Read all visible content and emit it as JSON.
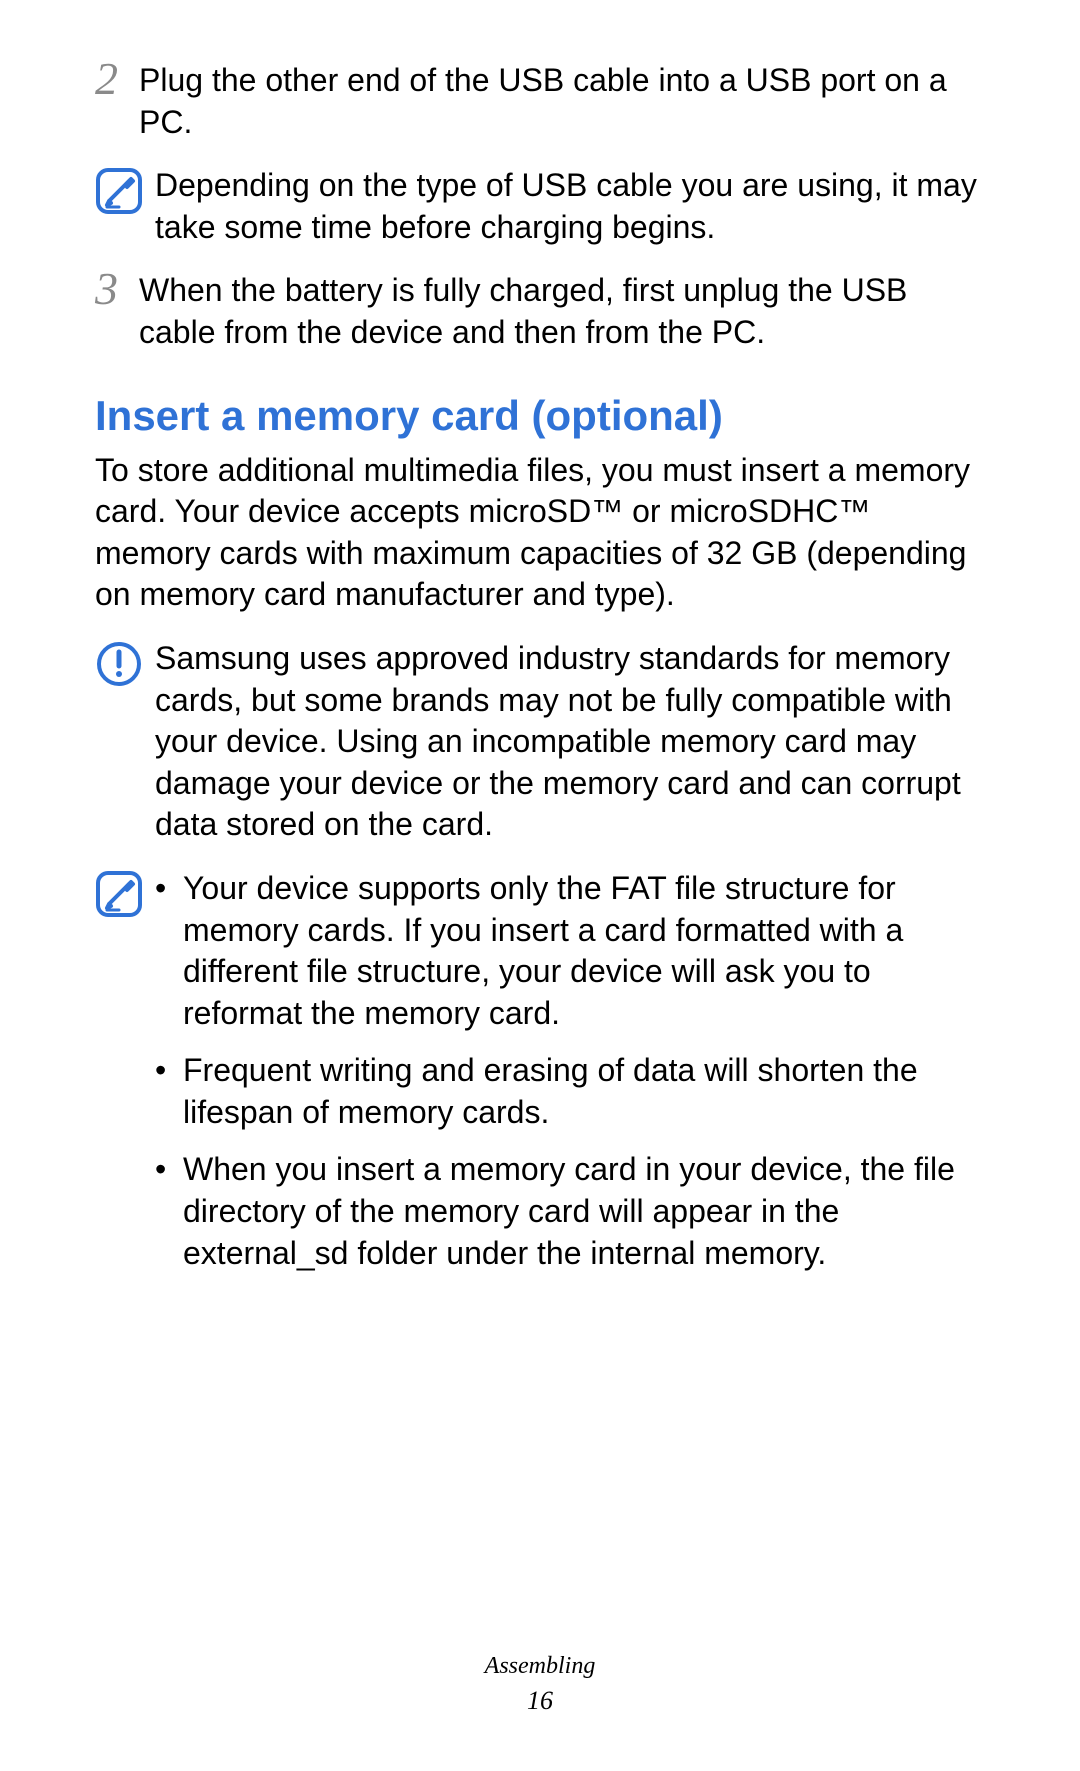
{
  "colors": {
    "heading": "#2f72d6",
    "icon_stroke": "#2f72d6",
    "step_num": "#8a8a8a"
  },
  "steps": [
    {
      "num": "2",
      "text": "Plug the other end of the USB cable into a USB port on a PC."
    },
    {
      "num": "3",
      "text": "When the battery is fully charged, first unplug the USB cable from the device and then from the PC."
    }
  ],
  "note_after_step2": "Depending on the type of USB cable you are using, it may take some time before charging begins.",
  "heading": "Insert a memory card (optional)",
  "intro": "To store additional multimedia files, you must insert a memory card. Your device accepts microSD™ or microSDHC™ memory cards with maximum capacities of 32 GB (depending on memory card manufacturer and type).",
  "warning": "Samsung uses approved industry standards for memory cards, but some brands may not be fully compatible with your device. Using an incompatible memory card may damage your device or the memory card and can corrupt data stored on the card.",
  "info_bullets": [
    "Your device supports only the FAT file structure for memory cards. If you insert a card formatted with a different file structure, your device will ask you to reformat the memory card.",
    "Frequent writing and erasing of data will shorten the lifespan of memory cards.",
    "When you insert a memory card in your device, the file directory of the memory card will appear in the external_sd folder under the internal memory."
  ],
  "footer": {
    "section": "Assembling",
    "page": "16"
  }
}
